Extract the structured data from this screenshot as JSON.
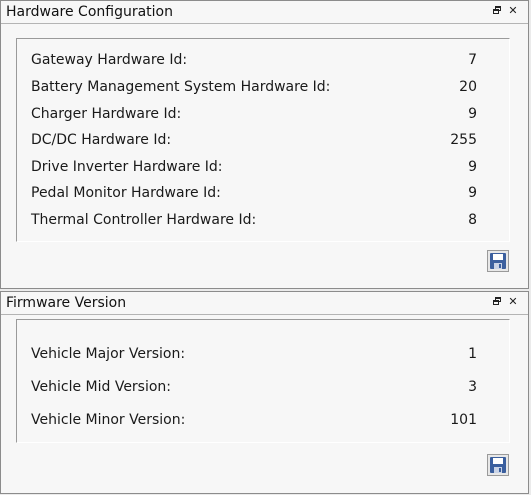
{
  "hardware_panel": {
    "title": "Hardware Configuration",
    "rows": [
      {
        "label": "Gateway Hardware Id:",
        "value": "7"
      },
      {
        "label": "Battery Management System Hardware Id:",
        "value": "20"
      },
      {
        "label": "Charger Hardware Id:",
        "value": "9"
      },
      {
        "label": "DC/DC Hardware Id:",
        "value": "255"
      },
      {
        "label": "Drive Inverter Hardware Id:",
        "value": "9"
      },
      {
        "label": "Pedal Monitor Hardware Id:",
        "value": "9"
      },
      {
        "label": "Thermal Controller Hardware Id:",
        "value": "8"
      }
    ]
  },
  "firmware_panel": {
    "title": "Firmware Version",
    "rows": [
      {
        "label": "Vehicle Major Version:",
        "value": "1"
      },
      {
        "label": "Vehicle Mid Version:",
        "value": "3"
      },
      {
        "label": "Vehicle Minor Version:",
        "value": "101"
      }
    ]
  },
  "header_buttons": {
    "close_glyph": "✕",
    "restore_icon": "restore-icon",
    "close_icon": "close-icon"
  },
  "footer_buttons": {
    "save_icon": "save-icon"
  },
  "colors": {
    "background": "#ebebeb",
    "panel": "#f7f7f7",
    "border": "#8c8c8c",
    "save_icon_blue": "#3b5f9e"
  }
}
